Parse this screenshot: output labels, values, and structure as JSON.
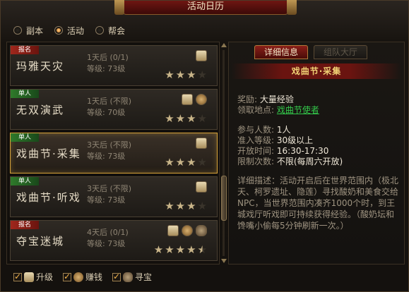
{
  "window": {
    "title": "活动日历"
  },
  "top_tabs": [
    {
      "label": "副本",
      "selected": false
    },
    {
      "label": "活动",
      "selected": true
    },
    {
      "label": "帮会",
      "selected": false
    }
  ],
  "activities": [
    {
      "badge": "报名",
      "badge_color": "red",
      "name": "玛雅天灾",
      "time": "1天后 (0/1)",
      "level": "等级:  73级",
      "icons": [
        "scroll-icon"
      ],
      "stars": 3,
      "max_stars": 4
    },
    {
      "badge": "单人",
      "badge_color": "green",
      "name": "无双演武",
      "time": "1天后 (不限)",
      "level": "等级:  70级",
      "icons": [
        "scroll-icon",
        "money-icon"
      ],
      "stars": 3,
      "max_stars": 4
    },
    {
      "badge": "单人",
      "badge_color": "green",
      "name": "戏曲节·采集",
      "time": "3天后 (不限)",
      "level": "等级:  73级",
      "icons": [
        "scroll-icon"
      ],
      "stars": 3,
      "max_stars": 4,
      "selected": true
    },
    {
      "badge": "单人",
      "badge_color": "green",
      "name": "戏曲节·听戏",
      "time": "3天后 (不限)",
      "level": "等级:  73级",
      "icons": [
        "scroll-icon"
      ],
      "stars": 3,
      "max_stars": 4
    },
    {
      "badge": "报名",
      "badge_color": "red",
      "name": "夺宝迷城",
      "time": "4天后 (0/1)",
      "level": "等级:  73级",
      "icons": [
        "scroll-icon",
        "money-icon",
        "treasure-icon"
      ],
      "stars": 4.5,
      "max_stars": 5
    }
  ],
  "detail": {
    "tabs": {
      "info": "详细信息",
      "team": "组队大厅"
    },
    "title": "戏曲节·采集",
    "reward_label": "奖励:",
    "reward_value": "大量经验",
    "location_label": "领取地点:",
    "location_value": "戏曲节使者",
    "players_label": "参与人数:",
    "players_value": "1人",
    "level_label": "准入等级:",
    "level_value": "30级以上",
    "open_label": "开放时间:",
    "open_value": "16:30-17:30",
    "limit_label": "限制次数:",
    "limit_value": "不限(每周六开放)",
    "description": "详细描述：活动开启后在世界范围内（极北天、柯罗遗址、隐莲）寻找酸奶和美食交给NPC，当世界范围内凑齐1000个时，到王城戏厅听戏即可持续获得经验。（酸奶坛和馋嘴小偷每5分钟刷新一次。）"
  },
  "filters": [
    {
      "label": "升级",
      "icon": "scroll-icon",
      "checked": true
    },
    {
      "label": "赚钱",
      "icon": "money-icon",
      "checked": true
    },
    {
      "label": "寻宝",
      "icon": "treasure-icon",
      "checked": true
    }
  ]
}
